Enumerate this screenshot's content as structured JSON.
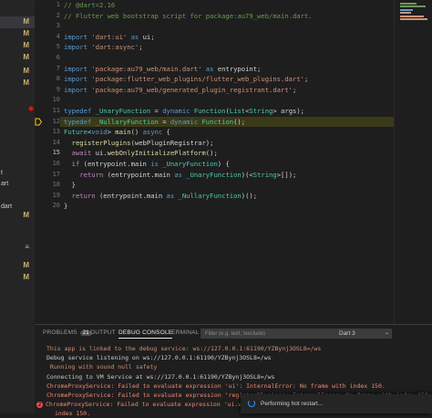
{
  "sidebar": {
    "items": [
      {
        "text": "",
        "mark": "M",
        "selected": true
      },
      {
        "text": "",
        "mark": "M"
      },
      {
        "text": "",
        "mark": "M"
      },
      {
        "text": "",
        "mark": "M"
      },
      {
        "text": "",
        "mark": "M"
      },
      {
        "text": "",
        "mark": "M"
      },
      {
        "text": "t",
        "mark": ""
      },
      {
        "text": "art",
        "mark": ""
      },
      {
        "text": "",
        "mark": ""
      },
      {
        "text": "dart",
        "mark": ""
      },
      {
        "text": "",
        "mark": "M"
      },
      {
        "text": "",
        "mark": "≡"
      },
      {
        "text": "",
        "mark": "M"
      },
      {
        "text": "",
        "mark": "M"
      }
    ]
  },
  "editor": {
    "line_numbers": [
      "1",
      "2",
      "3",
      "4",
      "5",
      "6",
      "7",
      "8",
      "9",
      "10",
      "11",
      "12",
      "13",
      "14",
      "15",
      "16",
      "17",
      "18",
      "19",
      "20"
    ],
    "current_line": "15",
    "lines": [
      [
        {
          "t": "// @dart=2.16",
          "c": "c-com"
        }
      ],
      [
        {
          "t": "// Flutter web bootstrap script for package:au79_web/main.dart.",
          "c": "c-com"
        }
      ],
      [],
      [
        {
          "t": "import ",
          "c": "c-kw"
        },
        {
          "t": "'dart:ui'",
          "c": "c-str"
        },
        {
          "t": " as ",
          "c": "c-kw"
        },
        {
          "t": "ui;",
          "c": ""
        }
      ],
      [
        {
          "t": "import ",
          "c": "c-kw"
        },
        {
          "t": "'dart:async'",
          "c": "c-str"
        },
        {
          "t": ";",
          "c": ""
        }
      ],
      [],
      [
        {
          "t": "import ",
          "c": "c-kw"
        },
        {
          "t": "'package:au79_web/main.dart'",
          "c": "c-str"
        },
        {
          "t": " as ",
          "c": "c-kw"
        },
        {
          "t": "entrypoint;",
          "c": ""
        }
      ],
      [
        {
          "t": "import ",
          "c": "c-kw"
        },
        {
          "t": "'package:flutter_web_plugins/flutter_web_plugins.dart'",
          "c": "c-str"
        },
        {
          "t": ";",
          "c": ""
        }
      ],
      [
        {
          "t": "import ",
          "c": "c-kw"
        },
        {
          "t": "'package:au79_web/generated_plugin_registrant.dart'",
          "c": "c-str"
        },
        {
          "t": ";",
          "c": ""
        }
      ],
      [],
      [
        {
          "t": "typedef ",
          "c": "c-kw"
        },
        {
          "t": "_UnaryFunction",
          "c": "c-ty"
        },
        {
          "t": " = ",
          "c": ""
        },
        {
          "t": "dynamic ",
          "c": "c-kw"
        },
        {
          "t": "Function",
          "c": "c-ty"
        },
        {
          "t": "(",
          "c": ""
        },
        {
          "t": "List",
          "c": "c-ty"
        },
        {
          "t": "<",
          "c": ""
        },
        {
          "t": "String",
          "c": "c-ty"
        },
        {
          "t": "> args);",
          "c": ""
        }
      ],
      [
        {
          "t": "typedef ",
          "c": "c-kw"
        },
        {
          "t": "_NullaryFunction",
          "c": "c-ty"
        },
        {
          "t": " = ",
          "c": ""
        },
        {
          "t": "dynamic ",
          "c": "c-kw"
        },
        {
          "t": "Function",
          "c": "c-ty"
        },
        {
          "t": "();",
          "c": ""
        }
      ],
      [
        {
          "t": "Future",
          "c": "c-ty"
        },
        {
          "t": "<",
          "c": ""
        },
        {
          "t": "void",
          "c": "c-kw"
        },
        {
          "t": "> ",
          "c": ""
        },
        {
          "t": "main",
          "c": "c-fn"
        },
        {
          "t": "() ",
          "c": ""
        },
        {
          "t": "async",
          "c": "c-kw"
        },
        {
          "t": " {",
          "c": ""
        }
      ],
      [
        {
          "t": "  ",
          "c": ""
        },
        {
          "t": "registerPlugins",
          "c": "c-fn"
        },
        {
          "t": "(webPluginRegistrar);",
          "c": ""
        }
      ],
      [
        {
          "t": "  ",
          "c": ""
        },
        {
          "t": "await ",
          "c": "c-ctl"
        },
        {
          "t": "ui.",
          "c": ""
        },
        {
          "t": "webOnlyInitializePlatform",
          "c": "c-fn"
        },
        {
          "t": "();",
          "c": ""
        }
      ],
      [
        {
          "t": "  ",
          "c": ""
        },
        {
          "t": "if ",
          "c": "c-ctl"
        },
        {
          "t": "(entrypoint.main ",
          "c": ""
        },
        {
          "t": "is ",
          "c": "c-kw"
        },
        {
          "t": "_UnaryFunction",
          "c": "c-ty"
        },
        {
          "t": ") {",
          "c": ""
        }
      ],
      [
        {
          "t": "    ",
          "c": ""
        },
        {
          "t": "return ",
          "c": "c-ctl"
        },
        {
          "t": "(entrypoint.main ",
          "c": ""
        },
        {
          "t": "as ",
          "c": "c-kw"
        },
        {
          "t": "_UnaryFunction",
          "c": "c-ty"
        },
        {
          "t": ")(<",
          "c": ""
        },
        {
          "t": "String",
          "c": "c-ty"
        },
        {
          "t": ">[]);",
          "c": ""
        }
      ],
      [
        {
          "t": "  }",
          "c": ""
        }
      ],
      [
        {
          "t": "  ",
          "c": ""
        },
        {
          "t": "return ",
          "c": "c-ctl"
        },
        {
          "t": "(entrypoint.main ",
          "c": ""
        },
        {
          "t": "as ",
          "c": "c-kw"
        },
        {
          "t": "_NullaryFunction",
          "c": "c-ty"
        },
        {
          "t": ")();",
          "c": ""
        }
      ],
      [
        {
          "t": "}",
          "c": ""
        }
      ]
    ]
  },
  "panel": {
    "tabs": [
      "PROBLEMS",
      "OUTPUT",
      "DEBUG CONSOLE",
      "TERMINAL"
    ],
    "problems_count": "21",
    "active_tab": "DEBUG CONSOLE",
    "filter_placeholder": "Filter (e.g. text, !exclude)",
    "session_select": "Dart 3",
    "output_lines": [
      {
        "t": "This app is linked to the debug service: ws://127.0.0.1:61190/YZBynj3OSL8=/ws",
        "color": "#ce9178",
        "err": false
      },
      {
        "t": "Debug service listening on ws://127.0.0.1:61190/YZBynj3OSL8=/ws",
        "color": "#cccccc",
        "err": false
      },
      {
        "t": " Running with sound null safety",
        "color": "#ce9178",
        "err": false
      },
      {
        "t": "Connecting to VM Service at ws://127.0.0.1:61190/YZBynj3OSL8=/ws",
        "color": "#cccccc",
        "err": false
      },
      {
        "t": "ChromeProxyService: Failed to evaluate expression 'ui': InternalError: No frame with index 150.",
        "color": "#f48771",
        "err": false
      },
      {
        "t": "ChromeProxyService: Failed to evaluate expression 'registerPlugins': InternalError: No frame with index 150.",
        "color": "#f48771",
        "err": false
      },
      {
        "t": "ChromeProxyService: Failed to evaluate expression 'ui.w",
        "color": "#f48771",
        "err": true,
        "count": "2"
      },
      {
        "t": "index 150.",
        "color": "#f48771",
        "err": false
      }
    ]
  },
  "toast": {
    "text": "Performing hot restart..."
  },
  "colors": {
    "accent": "#3794ff",
    "error": "#f14c4c",
    "modified": "#c9b36a"
  }
}
